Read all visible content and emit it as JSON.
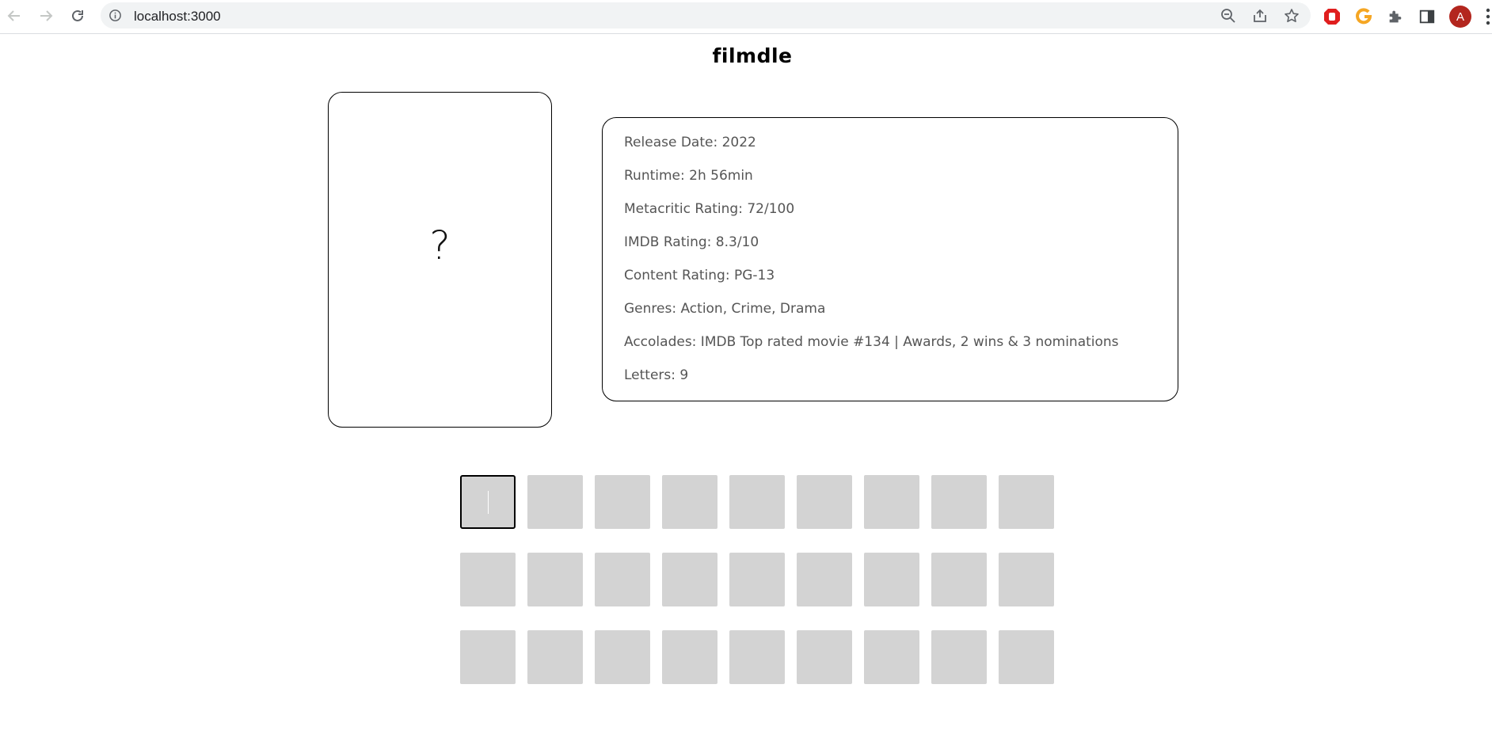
{
  "browser": {
    "url": "localhost:3000",
    "icons": {
      "back": "arrow-left-icon",
      "forward": "arrow-right-icon",
      "reload": "reload-icon",
      "site_info": "info-icon",
      "zoom": "zoom-out-icon",
      "share": "share-icon",
      "bookmark": "star-icon",
      "ext_adblock": "adblock-icon",
      "ext_g": "grammarly-like-icon",
      "extensions": "puzzle-icon",
      "side_panel": "side-panel-icon",
      "menu": "kebab-menu-icon"
    },
    "avatar_letter": "A",
    "colors": {
      "avatar": "#b3261e",
      "adblock": "#e01e1e",
      "ext_g": "#f5a623"
    }
  },
  "app": {
    "title": "filmdle",
    "poster_placeholder": "?",
    "info": [
      "Release Date: 2022",
      "Runtime: 2h 56min",
      "Metacritic Rating: 72/100",
      "IMDB Rating: 8.3/10",
      "Content Rating: PG-13",
      "Genres: Action, Crime, Drama",
      "Accolades: IMDB Top rated movie #134 | Awards, 2 wins & 3 nominations",
      "Letters: 9"
    ],
    "grid": {
      "rows": 3,
      "cols": 9,
      "active_row": 0,
      "active_col": 0,
      "tile_color": "#d3d3d3"
    }
  }
}
